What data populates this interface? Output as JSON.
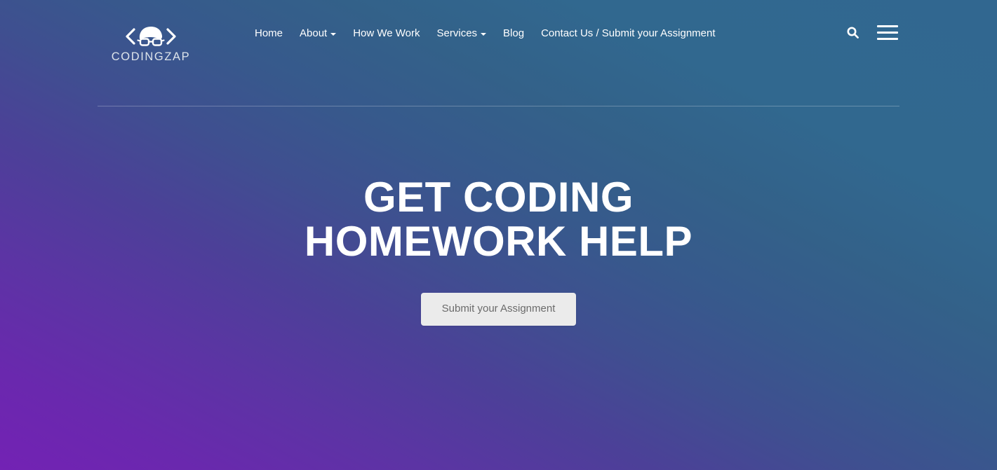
{
  "site": {
    "brand_name": "CODINGZAP",
    "logo_icon": "codingzap-logo-icon"
  },
  "header": {
    "nav": [
      {
        "label": "Home",
        "has_dropdown": false
      },
      {
        "label": "About",
        "has_dropdown": true
      },
      {
        "label": "How We Work",
        "has_dropdown": false
      },
      {
        "label": "Services",
        "has_dropdown": true
      },
      {
        "label": "Blog",
        "has_dropdown": false
      },
      {
        "label": "Contact Us / Submit your Assignment",
        "has_dropdown": false
      }
    ],
    "tools": {
      "search_icon": "search-icon",
      "menu_icon": "hamburger-menu-icon"
    }
  },
  "hero": {
    "title_line_1": "GET CODING",
    "title_line_2": "HOMEWORK HELP",
    "cta_label": "Submit your Assignment"
  },
  "colors": {
    "background_blue": "#31688f",
    "background_purple": "#7322b4",
    "nav_text": "#ffffff",
    "brand_text": "#dde4ea",
    "cta_background": "#ebebeb",
    "cta_text": "#6b6b6b",
    "divider": "rgba(255,255,255,0.26)"
  }
}
